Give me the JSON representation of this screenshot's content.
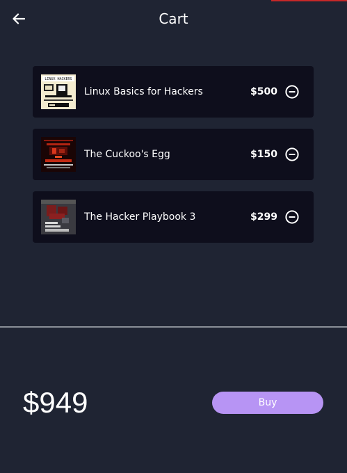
{
  "header": {
    "title": "Cart",
    "back_icon": "arrow-left-icon"
  },
  "cart": {
    "items": [
      {
        "title": "Linux Basics for Hackers",
        "price": "$500",
        "cover_text": "LINUX BASICS FOR HACKERS"
      },
      {
        "title": "The Cuckoo's Egg",
        "price": "$150",
        "cover_text": "CUCKOO'S EGG"
      },
      {
        "title": "The Hacker Playbook 3",
        "price": "$299",
        "cover_text": "THE HACKER PLAYBOOK"
      }
    ],
    "remove_icon": "minus-circle-icon"
  },
  "footer": {
    "total": "$949",
    "buy_label": "Buy"
  },
  "colors": {
    "background": "#1f2433",
    "card": "#0e0e1c",
    "accent": "#b794f4",
    "top_accent": "#c62828"
  }
}
